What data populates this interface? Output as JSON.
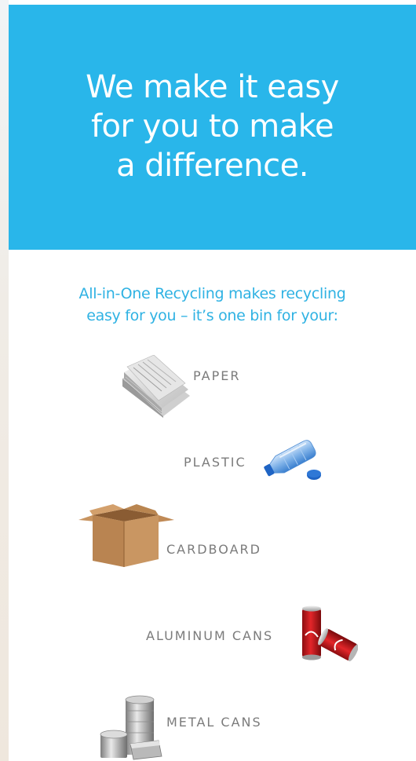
{
  "hero": {
    "title_lines": [
      "We make it easy",
      "for you to make",
      "a difference."
    ],
    "background": "#29b6ea"
  },
  "intro": {
    "lines": [
      "All-in-One Recycling makes recycling",
      "easy for you – it’s one bin for your:"
    ],
    "color": "#2fb2e3"
  },
  "items": [
    {
      "label": "PAPER",
      "icon": "newspaper-stack-icon"
    },
    {
      "label": "PLASTIC",
      "icon": "plastic-bottle-icon"
    },
    {
      "label": "CARDBOARD",
      "icon": "cardboard-box-icon"
    },
    {
      "label": "ALUMINUM CANS",
      "icon": "soda-cans-icon"
    },
    {
      "label": "METAL CANS",
      "icon": "metal-cans-icon"
    }
  ]
}
